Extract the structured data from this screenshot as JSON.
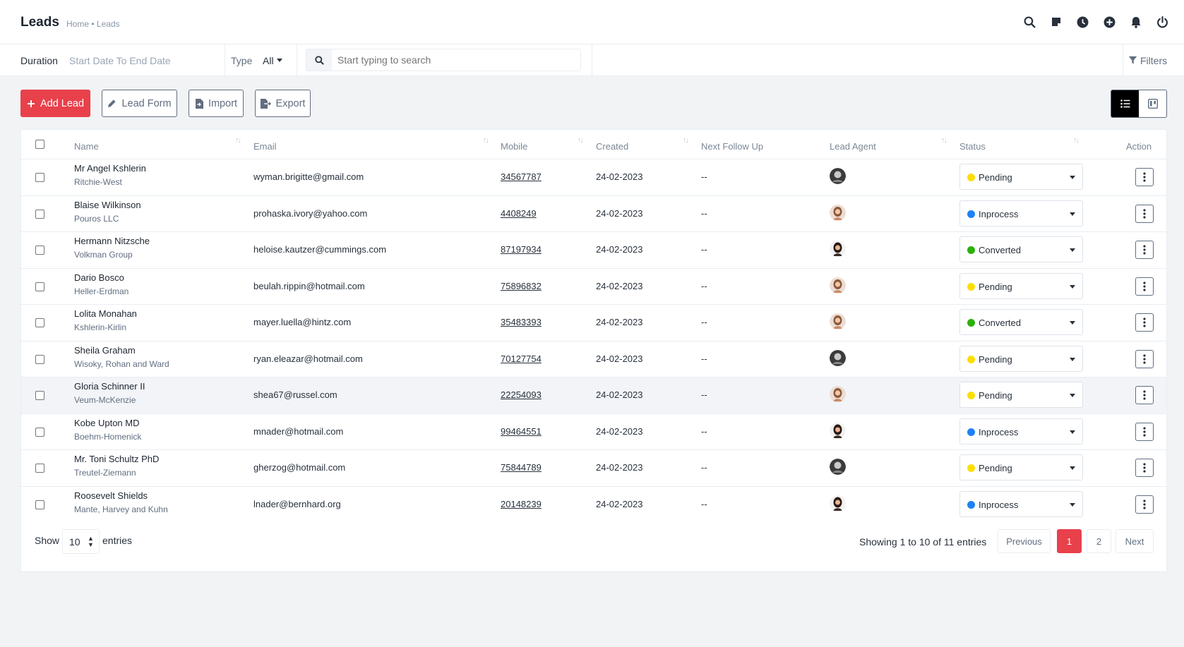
{
  "header": {
    "title": "Leads",
    "breadcrumb": [
      "Home",
      "•",
      "Leads"
    ],
    "icons": [
      "search-icon",
      "sticky-note-icon",
      "clock-icon",
      "plus-circle-icon",
      "bell-icon",
      "power-icon"
    ]
  },
  "filters": {
    "duration_label": "Duration",
    "duration_placeholder": "Start Date To End Date",
    "type_label": "Type",
    "type_value": "All",
    "search_placeholder": "Start typing to search",
    "filters_label": "Filters"
  },
  "actions": {
    "add_lead": "Add Lead",
    "lead_form": "Lead Form",
    "import": "Import",
    "export": "Export"
  },
  "table": {
    "columns": [
      "Name",
      "Email",
      "Mobile",
      "Created",
      "Next Follow Up",
      "Lead Agent",
      "Status",
      "Action"
    ],
    "rows": [
      {
        "name": "Mr Angel Kshlerin",
        "company": "Ritchie-West",
        "email": "wyman.brigitte@gmail.com",
        "mobile": "34567787",
        "created": "24-02-2023",
        "follow_up": "--",
        "agent": "dark",
        "status": "Pending"
      },
      {
        "name": "Blaise Wilkinson",
        "company": "Pouros LLC",
        "email": "prohaska.ivory@yahoo.com",
        "mobile": "4408249",
        "created": "24-02-2023",
        "follow_up": "--",
        "agent": "light",
        "status": "Inprocess"
      },
      {
        "name": "Hermann Nitzsche",
        "company": "Volkman Group",
        "email": "heloise.kautzer@cummings.com",
        "mobile": "87197934",
        "created": "24-02-2023",
        "follow_up": "--",
        "agent": "woman",
        "status": "Converted"
      },
      {
        "name": "Dario Bosco",
        "company": "Heller-Erdman",
        "email": "beulah.rippin@hotmail.com",
        "mobile": "75896832",
        "created": "24-02-2023",
        "follow_up": "--",
        "agent": "light",
        "status": "Pending"
      },
      {
        "name": "Lolita Monahan",
        "company": "Kshlerin-Kirlin",
        "email": "mayer.luella@hintz.com",
        "mobile": "35483393",
        "created": "24-02-2023",
        "follow_up": "--",
        "agent": "light",
        "status": "Converted"
      },
      {
        "name": "Sheila Graham",
        "company": "Wisoky, Rohan and Ward",
        "email": "ryan.eleazar@hotmail.com",
        "mobile": "70127754",
        "created": "24-02-2023",
        "follow_up": "--",
        "agent": "dark",
        "status": "Pending"
      },
      {
        "name": "Gloria Schinner II",
        "company": "Veum-McKenzie",
        "email": "shea67@russel.com",
        "mobile": "22254093",
        "created": "24-02-2023",
        "follow_up": "--",
        "agent": "light",
        "status": "Pending"
      },
      {
        "name": "Kobe Upton MD",
        "company": "Boehm-Homenick",
        "email": "mnader@hotmail.com",
        "mobile": "99464551",
        "created": "24-02-2023",
        "follow_up": "--",
        "agent": "woman",
        "status": "Inprocess"
      },
      {
        "name": "Mr. Toni Schultz PhD",
        "company": "Treutel-Ziemann",
        "email": "gherzog@hotmail.com",
        "mobile": "75844789",
        "created": "24-02-2023",
        "follow_up": "--",
        "agent": "dark",
        "status": "Pending"
      },
      {
        "name": "Roosevelt Shields",
        "company": "Mante, Harvey and Kuhn",
        "email": "lnader@bernhard.org",
        "mobile": "20148239",
        "created": "24-02-2023",
        "follow_up": "--",
        "agent": "woman",
        "status": "Inprocess"
      }
    ]
  },
  "status_colors": {
    "Pending": "#fcde05",
    "Inprocess": "#1d82f5",
    "Converted": "#2bb00c"
  },
  "footer": {
    "show_label": "Show",
    "page_size": "10",
    "entries_label": "entries",
    "summary": "Showing 1 to 10 of 11 entries",
    "previous": "Previous",
    "pages": [
      "1",
      "2"
    ],
    "next": "Next"
  },
  "colors": {
    "accent": "#e8414b",
    "text": "#28313c",
    "muted": "#616e80"
  }
}
